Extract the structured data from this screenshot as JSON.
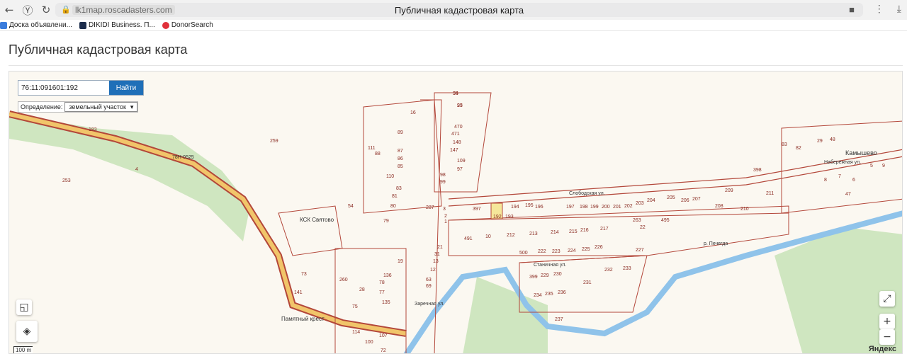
{
  "browser": {
    "url": "lk1map.roscadasters.com",
    "tab_title": "Публичная кадастровая карта",
    "bookmarks": [
      {
        "label": "Доска объявлени...",
        "color": "#3b7ddd"
      },
      {
        "label": "DIKIDI Business. П...",
        "color": "#1c2c4c"
      },
      {
        "label": "DonorSearch",
        "color": "#e0303a"
      }
    ]
  },
  "page": {
    "title": "Публичная кадастровая карта"
  },
  "map": {
    "search_value": "76:11:091601:192",
    "search_button": "Найти",
    "definition_label": "Определение:",
    "definition_value": "земельный участок",
    "scale_label": "100 m",
    "logo": "Яндекс",
    "zoom_in": "+",
    "zoom_out": "−",
    "colors": {
      "parcel": "#b3473a",
      "road": "#f1c56a",
      "river": "#8fc3ea",
      "forest": "#cfe6c0",
      "selected": "#f5e79a"
    },
    "place_labels": [
      "КСК Святово",
      "Памятный крест",
      "Камышево",
      "Слободская ул.",
      "Набережная ул.",
      "Станичная ул.",
      "Заречная ул.",
      "р. Печегда",
      "78Н-0525"
    ],
    "parcel_numbers": [
      "55",
      "93",
      "16",
      "470",
      "471",
      "148",
      "147",
      "109",
      "97",
      "98",
      "99",
      "89",
      "111",
      "88",
      "87",
      "86",
      "85",
      "110",
      "83",
      "81",
      "80",
      "79",
      "54",
      "259",
      "253",
      "183",
      "4",
      "287",
      "3",
      "2",
      "1",
      "397",
      "195",
      "192",
      "193",
      "194",
      "196",
      "197",
      "198",
      "199",
      "200",
      "201",
      "202",
      "203",
      "204",
      "205",
      "206",
      "207",
      "208",
      "209",
      "210",
      "211",
      "398",
      "83",
      "82",
      "29",
      "48",
      "47",
      "6",
      "7",
      "8",
      "5",
      "9",
      "10",
      "212",
      "213",
      "214",
      "215",
      "216",
      "217",
      "263",
      "22",
      "495",
      "500",
      "222",
      "223",
      "224",
      "225",
      "226",
      "227",
      "491",
      "399",
      "229",
      "230",
      "231",
      "232",
      "233",
      "234",
      "235",
      "236",
      "237",
      "73",
      "260",
      "28",
      "136",
      "78",
      "77",
      "135",
      "75",
      "114",
      "107",
      "100",
      "72",
      "141",
      "69",
      "63",
      "12",
      "13",
      "31",
      "21",
      "19",
      "34",
      "25"
    ]
  }
}
